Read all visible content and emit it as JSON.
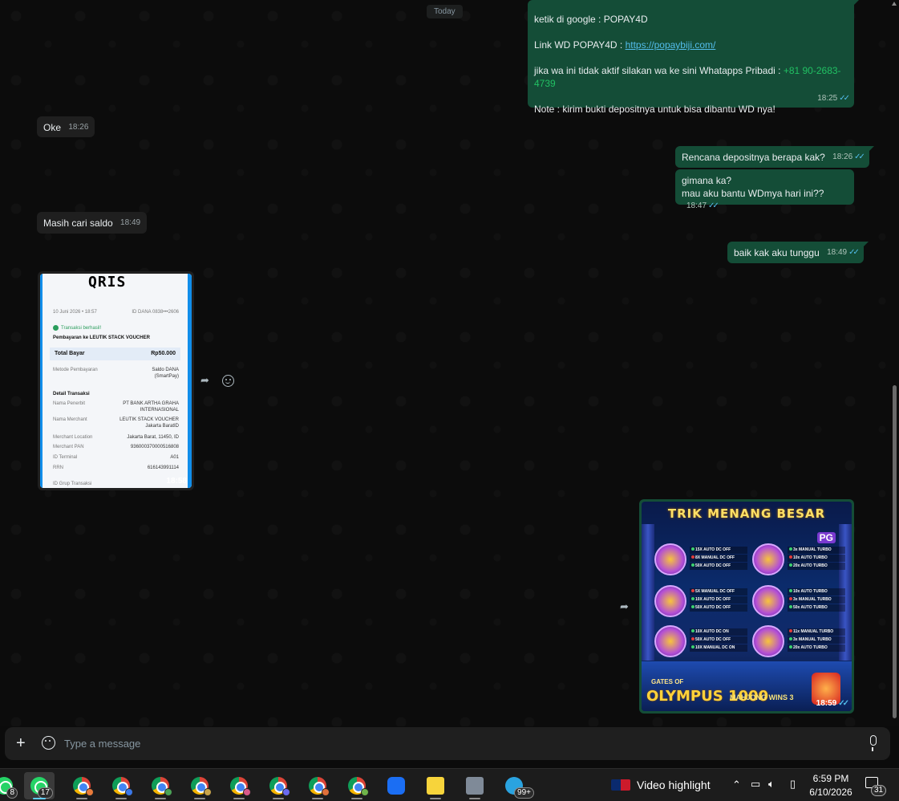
{
  "chat": {
    "date_chip": "Today",
    "messages": [
      {
        "id": "info",
        "line1": "ketik di google : POPAY4D",
        "line2_prefix": "Link WD POPAY4D  : ",
        "line2_link": "https://popaybiji.com/",
        "line3_prefix": "jika wa ini tidak aktif silakan wa ke sini Whatapps Pribadi : ",
        "line3_phone": "+81 90-2683-4739",
        "line4": "Note : kirim bukti depositnya untuk bisa dibantu WD nya!",
        "time": "18:25"
      },
      {
        "id": "oke",
        "text": "Oke",
        "time": "18:26"
      },
      {
        "id": "rencana",
        "text": "Rencana depositnya berapa kak?",
        "time": "18:26"
      },
      {
        "id": "gimana",
        "line1": "gimana ka?",
        "line2": "mau aku bantu WDmya hari ini??",
        "time": "18:47"
      },
      {
        "id": "masih",
        "text": "Masih cari saldo",
        "time": "18:49"
      },
      {
        "id": "baik",
        "text": "baik kak aku tunggu",
        "time": "18:49"
      }
    ],
    "receipt": {
      "logo": "QRIS",
      "date": "10 Juni 2026 • 18:57",
      "id_dana": "ID DANA 0838•••2606",
      "status": "Transaksi berhasil!",
      "payee": "Pembayaran ke LEUTIK STACK VOUCHER",
      "total_label": "Total Bayar",
      "total_value": "Rp50.000",
      "method_label": "Metode Pembayaran",
      "method_value": "Saldo DANA (SmartPay)",
      "detail_title": "Detail Transaksi",
      "rows": [
        {
          "label": "Nama Penerbit",
          "value": "PT BANK ARTHA GRAHA INTERNASIONAL"
        },
        {
          "label": "Nama Merchant",
          "value": "LEUTIK STACK VOUCHER Jakarta BaratID"
        },
        {
          "label": "Merchant Location",
          "value": "Jakarta Barat, 11450, ID"
        },
        {
          "label": "Merchant PAN",
          "value": "936000370000516808"
        },
        {
          "label": "ID Terminal",
          "value": "A01"
        },
        {
          "label": "RRN",
          "value": "616143991114"
        },
        {
          "label": "ID Grup Transaksi",
          "value": ""
        }
      ],
      "time": "18:58"
    },
    "promo": {
      "title": "TRIK MENANG BESAR",
      "pg_badge": "PG",
      "games": [
        {
          "name": "BIG BASS BONANZA",
          "lines": [
            "15X AUTO DC OFF",
            "8X MANUAL DC OFF",
            "50X AUTO DC OFF"
          ]
        },
        {
          "name": "JUNGLE DELIGHT",
          "lines": [
            "3x MANUAL TURBO",
            "10x AUTO TURBO",
            "20x AUTO TURBO"
          ]
        },
        {
          "name": "MAHJONG WINS 3",
          "lines": [
            "5X MANUAL DC OFF",
            "10X AUTO DC OFF",
            "50X AUTO DC OFF"
          ]
        },
        {
          "name": "MAHJONG WAYS 2",
          "lines": [
            "10x AUTO TURBO",
            "3x MANUAL TURBO",
            "50x AUTO TURBO"
          ]
        },
        {
          "name": "GATES OF OLYMPUS 1000",
          "lines": [
            "10X AUTO DC ON",
            "50X AUTO DC OFF",
            "10X MANUAL DC ON"
          ]
        },
        {
          "name": "MAHJONG WAYS",
          "lines": [
            "11x MANUAL TURBO",
            "3x MANUAL TURBO",
            "20x AUTO TURBO"
          ]
        }
      ],
      "logo_olympus_sub": "GATES OF",
      "logo_olympus": "OLYMPUS 1000",
      "logo_mahjong": "MAHJONG WINS 3",
      "time": "18:59"
    }
  },
  "composer": {
    "placeholder": "Type a message"
  },
  "taskbar": {
    "apps": [
      {
        "icon": "whatsapp-icon",
        "badge": "8"
      },
      {
        "icon": "whatsapp-icon",
        "badge": "17"
      },
      {
        "icon": "chrome-icon"
      },
      {
        "icon": "chrome-icon"
      },
      {
        "icon": "chrome-icon"
      },
      {
        "icon": "chrome-icon"
      },
      {
        "icon": "chrome-icon"
      },
      {
        "icon": "chrome-icon"
      },
      {
        "icon": "chrome-icon"
      },
      {
        "icon": "chrome-icon"
      },
      {
        "icon": "meta-icon"
      },
      {
        "icon": "sticky-notes-icon"
      },
      {
        "icon": "calculator-icon"
      },
      {
        "icon": "telegram-icon",
        "badge": "99+"
      }
    ],
    "widget_text": "Video highlight",
    "time": "6:59 PM",
    "date": "6/10/2026",
    "notification_count": "31"
  }
}
